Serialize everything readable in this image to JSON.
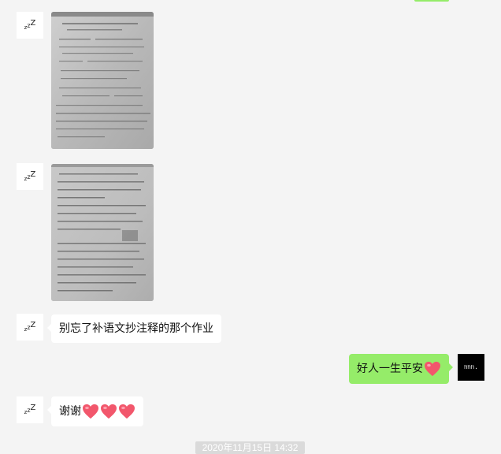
{
  "chat": {
    "messages": [
      {
        "sender": "contact",
        "type": "image",
        "avatar": "zzz"
      },
      {
        "sender": "contact",
        "type": "image",
        "avatar": "zzz"
      },
      {
        "sender": "contact",
        "type": "text",
        "avatar": "zzz",
        "text": "别忘了补语文抄注释的那个作业"
      },
      {
        "sender": "self",
        "type": "text",
        "avatar": "self",
        "avatar_text": "ᥒᥒᥒ.",
        "text": "好人一生平安",
        "hearts": 1
      },
      {
        "sender": "contact",
        "type": "text",
        "avatar": "zzz",
        "text": "谢谢",
        "hearts": 3
      }
    ],
    "timestamp": "2020年11月15日 14:32"
  },
  "colors": {
    "background": "#f4f4f4",
    "incoming_bubble": "#ffffff",
    "outgoing_bubble": "#95ec69",
    "timestamp_bg": "#dadada",
    "heart": "#f2576c"
  },
  "icons": {
    "contact_avatar": "zzz-avatar-icon",
    "self_avatar": "self-avatar-icon",
    "heart": "red-heart-emoji-icon"
  }
}
